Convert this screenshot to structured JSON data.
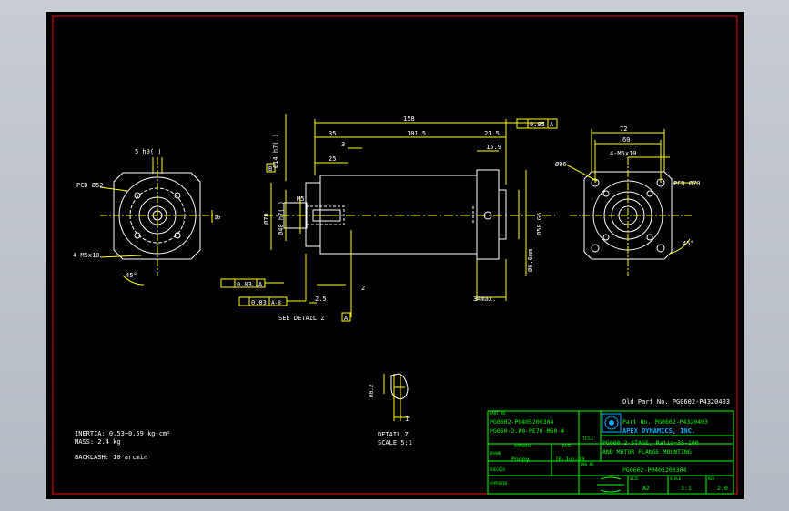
{
  "colors": {
    "background": "#000000",
    "border": "#ff0000",
    "drawing": "#ffffff",
    "dimension": "#ffff00",
    "titleblock": "#00ff00",
    "logo": "#00aaff"
  },
  "front_view": {
    "keyway": "5 h9( )",
    "pcd": "PCD Ø52",
    "thread": "4-M5x10",
    "angle": "45°",
    "keyhole": "16"
  },
  "side_view": {
    "overall_length": "158",
    "runout": "0.05",
    "runout_datum": "A",
    "dims": {
      "d35": "35",
      "d101": "101.5",
      "d215": "21.5",
      "d3": "3",
      "d25": "25",
      "d159": "15.9",
      "d25b": "2.5",
      "d2": "2",
      "d34max": "34max."
    },
    "shaft_diameter": "Ø14 h7( )",
    "flange_diameter": "Ø70",
    "pilot_diameter": "Ø40 h7( )",
    "thread_label": "M5",
    "motor_pilot": "Ø50 G6",
    "motor_bolt": "Ø6.6mm",
    "datum_b": "B",
    "tol1": "0.03",
    "tol1_datum": "A",
    "tol2": "0.03",
    "tol2_datum": "A-B",
    "see_detail": "SEE DETAIL Z",
    "datum_a": "A"
  },
  "rear_view": {
    "square1": "72",
    "square2": "60",
    "thread": "4-M5x10",
    "diameter": "Ø96",
    "pcd": "PCD Ø70",
    "angle": "45°"
  },
  "detail": {
    "label": "DETAIL Z",
    "scale": "SCALE 5:1",
    "r": "R0.2",
    "one": "1"
  },
  "notes": {
    "inertia": "INERTIA: 0.53~0.59 kg-cm²",
    "mass": "MASS: 2.4 kg",
    "backlash": "BACKLASH: 10 arcmin"
  },
  "title_block": {
    "old_part": "Old Part No. PG0602-P4320403",
    "part_no_label": "PART NO.",
    "part_no_1": "PG0602-P0405200304",
    "part_no_2": "PG060-2.A0-PE70-M60-4",
    "approval_label": "APPROVAL",
    "date_label": "DATE",
    "drawn_label": "DRAWN",
    "drawn_by": "Poopy",
    "drawn_date": "18-Jun-18",
    "checked_label": "CHECKED",
    "approved_label": "APPROVED",
    "logo_part": "Part No. PG0602-P4320403",
    "company": "APEX DYNAMICS, INC.",
    "title_label": "TITLE",
    "title_1": "PG060 2 STAGE, Ratio=35-100",
    "title_2": "AND MOTOR FLANGE MOUNTING",
    "dwg_label": "DWG NO.",
    "dwg_no": "PG0602-P0405200304",
    "size_label": "SIZE",
    "size": "A2",
    "scale_label": "SCALE",
    "scale": "3:1",
    "rev_label": "REV",
    "rev": "2.0"
  }
}
